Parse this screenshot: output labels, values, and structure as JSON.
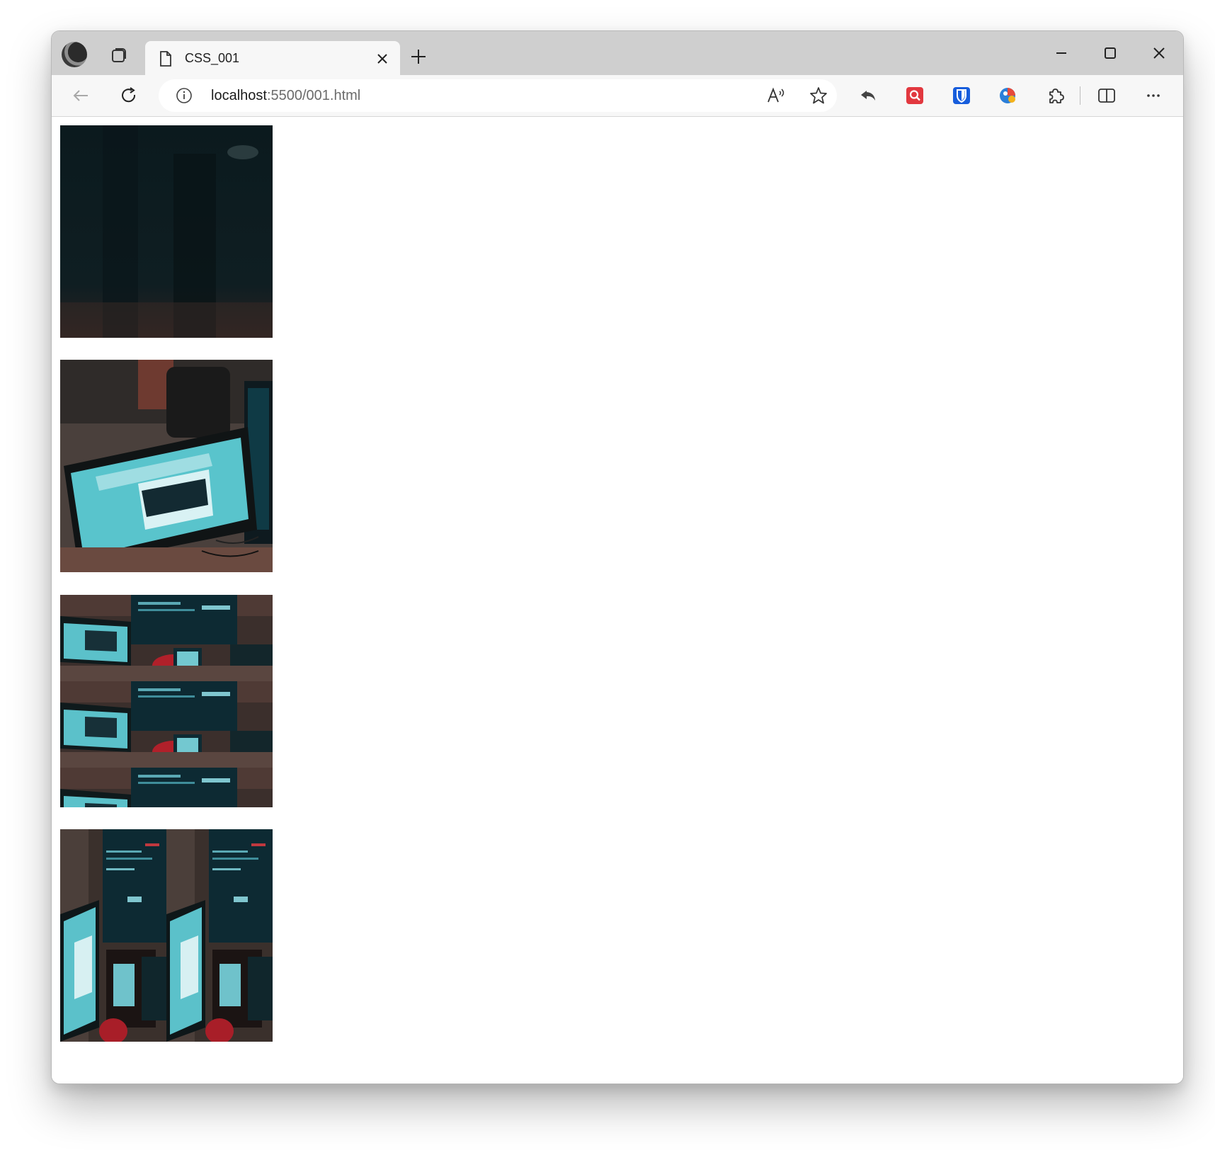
{
  "browser": {
    "tab": {
      "title": "CSS_001"
    },
    "address": {
      "host": "localhost",
      "path": ":5500/001.html"
    }
  },
  "icons": [
    "profile-avatar",
    "tab-actions-icon",
    "page-icon",
    "close-icon",
    "plus-icon",
    "minimize-icon",
    "maximize-icon",
    "back-arrow-icon",
    "refresh-icon",
    "info-icon",
    "read-aloud-icon",
    "star-icon",
    "share-back-icon",
    "search-extension-icon",
    "bitwarden-shield-icon",
    "colorful-extension-icon",
    "extensions-puzzle-icon",
    "split-screen-icon",
    "more-dots-icon"
  ],
  "colors": {
    "titlebar": "#cfcfcf",
    "toolbar": "#f7f7f7",
    "search_ext": "#e2383f",
    "bitwarden": "#175ddc"
  },
  "content": {
    "images": [
      {
        "name": "dark-blurred-photo"
      },
      {
        "name": "computer-monitor-photo"
      },
      {
        "name": "monitor-photo-repeat-y"
      },
      {
        "name": "monitor-photo-repeat-x"
      }
    ]
  }
}
